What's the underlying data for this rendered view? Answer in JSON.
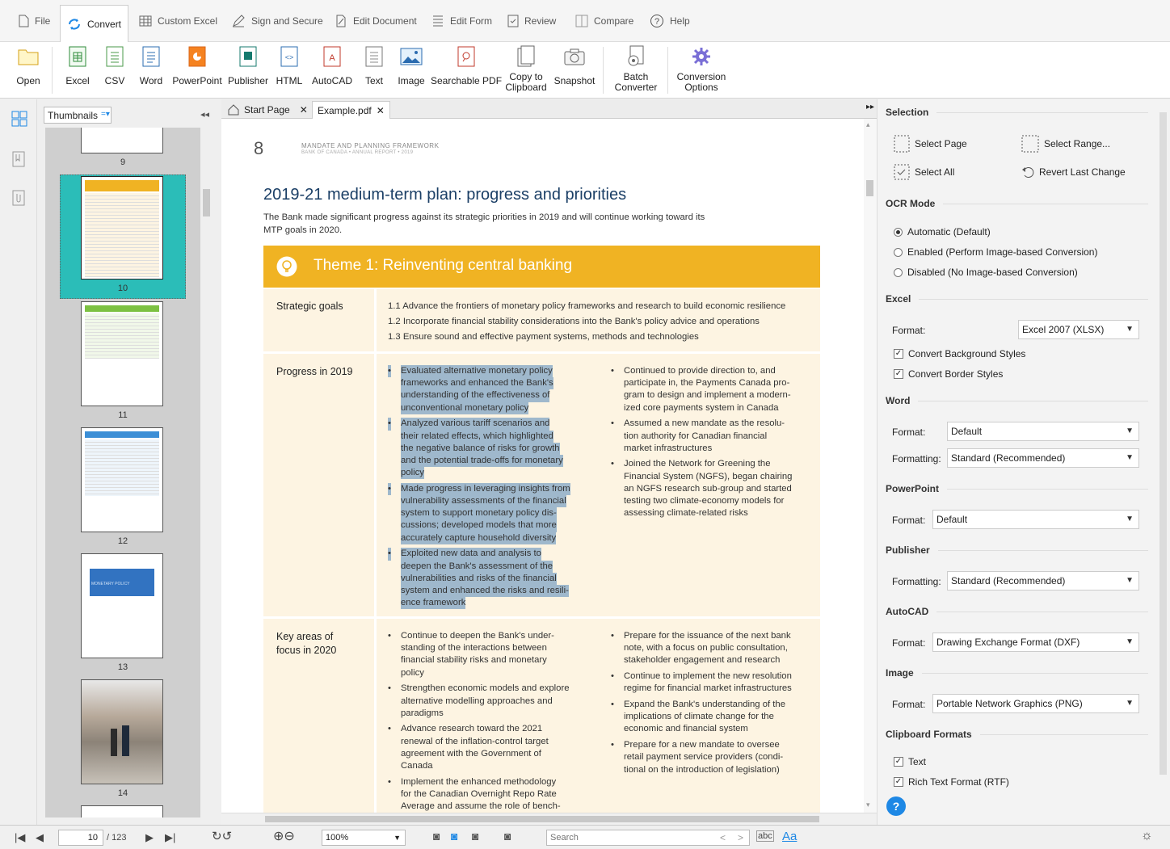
{
  "menu": {
    "items": [
      {
        "label": "File",
        "icon": "file-icon"
      },
      {
        "label": "Convert",
        "icon": "convert-icon",
        "active": true
      },
      {
        "label": "Custom Excel",
        "icon": "table-icon"
      },
      {
        "label": "Sign and Secure",
        "icon": "pen-icon"
      },
      {
        "label": "Edit Document",
        "icon": "edit-icon"
      },
      {
        "label": "Edit Form",
        "icon": "form-icon"
      },
      {
        "label": "Review",
        "icon": "review-icon"
      },
      {
        "label": "Compare",
        "icon": "compare-icon"
      },
      {
        "label": "Help",
        "icon": "help-icon"
      }
    ]
  },
  "ribbon": {
    "open": "Open",
    "excel": "Excel",
    "csv": "CSV",
    "word": "Word",
    "powerpoint": "PowerPoint",
    "publisher": "Publisher",
    "html": "HTML",
    "autocad": "AutoCAD",
    "text": "Text",
    "image": "Image",
    "searchable_pdf": "Searchable PDF",
    "copy1": "Copy to",
    "copy2": "Clipboard",
    "snapshot": "Snapshot",
    "batch1": "Batch",
    "batch2": "Converter",
    "conv1": "Conversion",
    "conv2": "Options"
  },
  "left": {
    "dropdown": "Thumbnails",
    "pages": [
      "9",
      "10",
      "11",
      "12",
      "13",
      "14"
    ],
    "thumb13_text": "MONETARY POLICY"
  },
  "tabs": {
    "start": "Start Page",
    "doc": "Example.pdf"
  },
  "doc": {
    "page_num": "8",
    "header1": "MANDATE AND PLANNING FRAMEWORK",
    "header2": "BANK OF CANADA  •  ANNUAL REPORT  •  2019",
    "title": "2019-21 medium-term plan: progress and priorities",
    "intro1": "The Bank made significant progress against its strategic priorities in 2019 and will continue working toward its",
    "intro2": "MTP goals in 2020.",
    "theme": "Theme 1: Reinventing central banking",
    "goals_label": "Strategic goals",
    "goals": [
      "1.1 Advance the frontiers of monetary policy frameworks and research to build economic resilience",
      "1.2 Incorporate financial stability considerations into the Bank's policy advice and operations",
      "1.3 Ensure sound and effective payment systems, methods and technologies"
    ],
    "progress_label": "Progress in 2019",
    "progress_left": [
      [
        "Evaluated alternative monetary policy",
        "frameworks and enhanced the Bank's",
        "understanding of the effectiveness of",
        "unconventional monetary policy"
      ],
      [
        "Analyzed various tariff scenarios and",
        "their related effects, which highlighted",
        "the negative balance of risks for growth",
        "and the potential trade-offs for monetary",
        "policy"
      ],
      [
        "Made progress in leveraging insights from",
        "vulnerability assessments of the financial",
        "system to support monetary policy dis-",
        "cussions; developed models that more",
        "accurately capture household diversity"
      ],
      [
        "Exploited new data and analysis to",
        "deepen the Bank's assessment of the",
        "vulnerabilities and risks of the financial",
        "system and enhanced the risks and resili-",
        "ence framework"
      ]
    ],
    "progress_right": [
      [
        "Continued to provide direction to, and",
        "participate in, the Payments Canada pro-",
        "gram to design and implement a modern-",
        "ized core payments system in Canada"
      ],
      [
        "Assumed a new mandate as the resolu-",
        "tion authority for Canadian financial",
        "market infrastructures"
      ],
      [
        "Joined the Network for Greening the",
        "Financial System (NGFS), began chairing",
        "an NGFS research sub-group and started",
        "testing two climate-economy models for",
        "assessing climate-related risks"
      ]
    ],
    "focus_label1": "Key areas of",
    "focus_label2": "focus in 2020",
    "focus_left": [
      [
        "Continue to deepen the Bank's under-",
        "standing of the interactions between",
        "financial stability risks and monetary",
        "policy"
      ],
      [
        "Strengthen economic models and explore",
        "alternative modelling approaches and",
        "paradigms"
      ],
      [
        "Advance research toward the 2021",
        "renewal of the inflation-control target",
        "agreement with the Government of",
        "Canada"
      ],
      [
        "Implement the enhanced methodology",
        "for the Canadian Overnight Repo Rate",
        "Average and assume the role of bench-"
      ]
    ],
    "focus_right": [
      [
        "Prepare for the issuance of the next bank",
        "note, with a focus on public consultation,",
        "stakeholder engagement and research"
      ],
      [
        "Continue to implement the new resolution",
        "regime for financial market infrastructures"
      ],
      [
        "Expand the Bank's understanding of the",
        "implications of climate change for the",
        "economic and financial system"
      ],
      [
        "Prepare for a new mandate to oversee",
        "retail payment service providers (condi-",
        "tional on the introduction of legislation)"
      ]
    ]
  },
  "right": {
    "selection": "Selection",
    "select_page": "Select Page",
    "select_range": "Select Range...",
    "select_all": "Select All",
    "revert": "Revert Last Change",
    "ocr": "OCR Mode",
    "ocr_auto": "Automatic (Default)",
    "ocr_enabled": "Enabled (Perform Image-based Conversion)",
    "ocr_disabled": "Disabled (No Image-based Conversion)",
    "excel": "Excel",
    "format": "Format:",
    "excel_format": "Excel 2007 (XLSX)",
    "excel_bg": "Convert Background Styles",
    "excel_border": "Convert Border Styles",
    "word": "Word",
    "word_format": "Default",
    "formatting": "Formatting:",
    "word_formatting": "Standard (Recommended)",
    "powerpoint": "PowerPoint",
    "ppt_format": "Default",
    "publisher": "Publisher",
    "pub_formatting": "Standard (Recommended)",
    "autocad": "AutoCAD",
    "autocad_format": "Drawing Exchange Format (DXF)",
    "image": "Image",
    "image_format": "Portable Network Graphics (PNG)",
    "clipboard": "Clipboard Formats",
    "cb_text": "Text",
    "cb_rtf": "Rich Text Format (RTF)"
  },
  "status": {
    "page": "10",
    "total": "/ 123",
    "zoom": "100%",
    "search_placeholder": "Search",
    "abc": "abc",
    "aa": "Aa"
  },
  "colors": {
    "theme": "#f0b323",
    "teal": "#2bbdb8",
    "highlight": "#9fb8cc",
    "title_blue": "#1b3f66",
    "help_blue": "#1e88e5"
  }
}
